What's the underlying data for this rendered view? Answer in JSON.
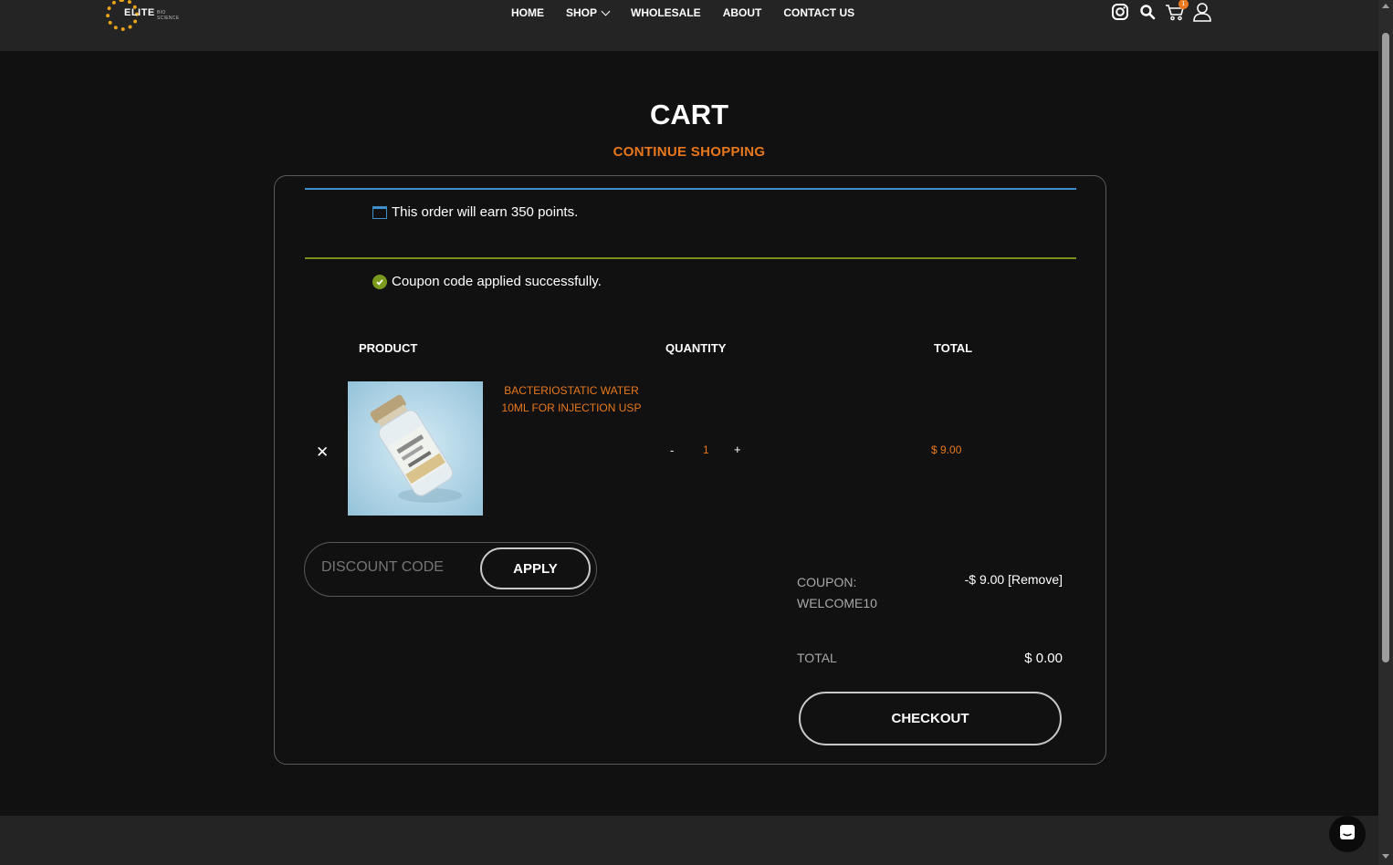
{
  "header": {
    "logo_text": "ELITE",
    "logo_sub": "BIO SCIENCE",
    "nav": [
      {
        "label": "HOME"
      },
      {
        "label": "SHOP"
      },
      {
        "label": "WHOLESALE"
      },
      {
        "label": "ABOUT"
      },
      {
        "label": "CONTACT US"
      }
    ],
    "icons": [
      "instagram-icon",
      "search-icon",
      "cart-icon",
      "user-icon"
    ],
    "cart_count": "1"
  },
  "page": {
    "title": "CART",
    "continue_label": "CONTINUE SHOPPING"
  },
  "notices": {
    "points": "This order will earn 350 points.",
    "coupon": "Coupon code applied successfully."
  },
  "table": {
    "headers": {
      "product": "PRODUCT",
      "quantity": "QUANTITY",
      "total": "TOTAL"
    },
    "remove_symbol": "✕",
    "item": {
      "name": "BACTERIOSTATIC WATER 10ML FOR INJECTION USP",
      "quantity": "1",
      "minus": "-",
      "plus": "+",
      "total": "$ 9.00"
    }
  },
  "discount": {
    "placeholder": "DISCOUNT CODE",
    "apply_label": "APPLY"
  },
  "summary": {
    "coupon_label": "COUPON: WELCOME10",
    "coupon_value": "-$ 9.00 [Remove]",
    "total_label": "TOTAL",
    "total_value": "$ 0.00",
    "checkout_label": "CHECKOUT"
  },
  "colors": {
    "accent": "#e8781b",
    "background": "#111111",
    "header": "#242424",
    "info_line": "#3d8ec9",
    "success_line": "#7a8e1f"
  }
}
